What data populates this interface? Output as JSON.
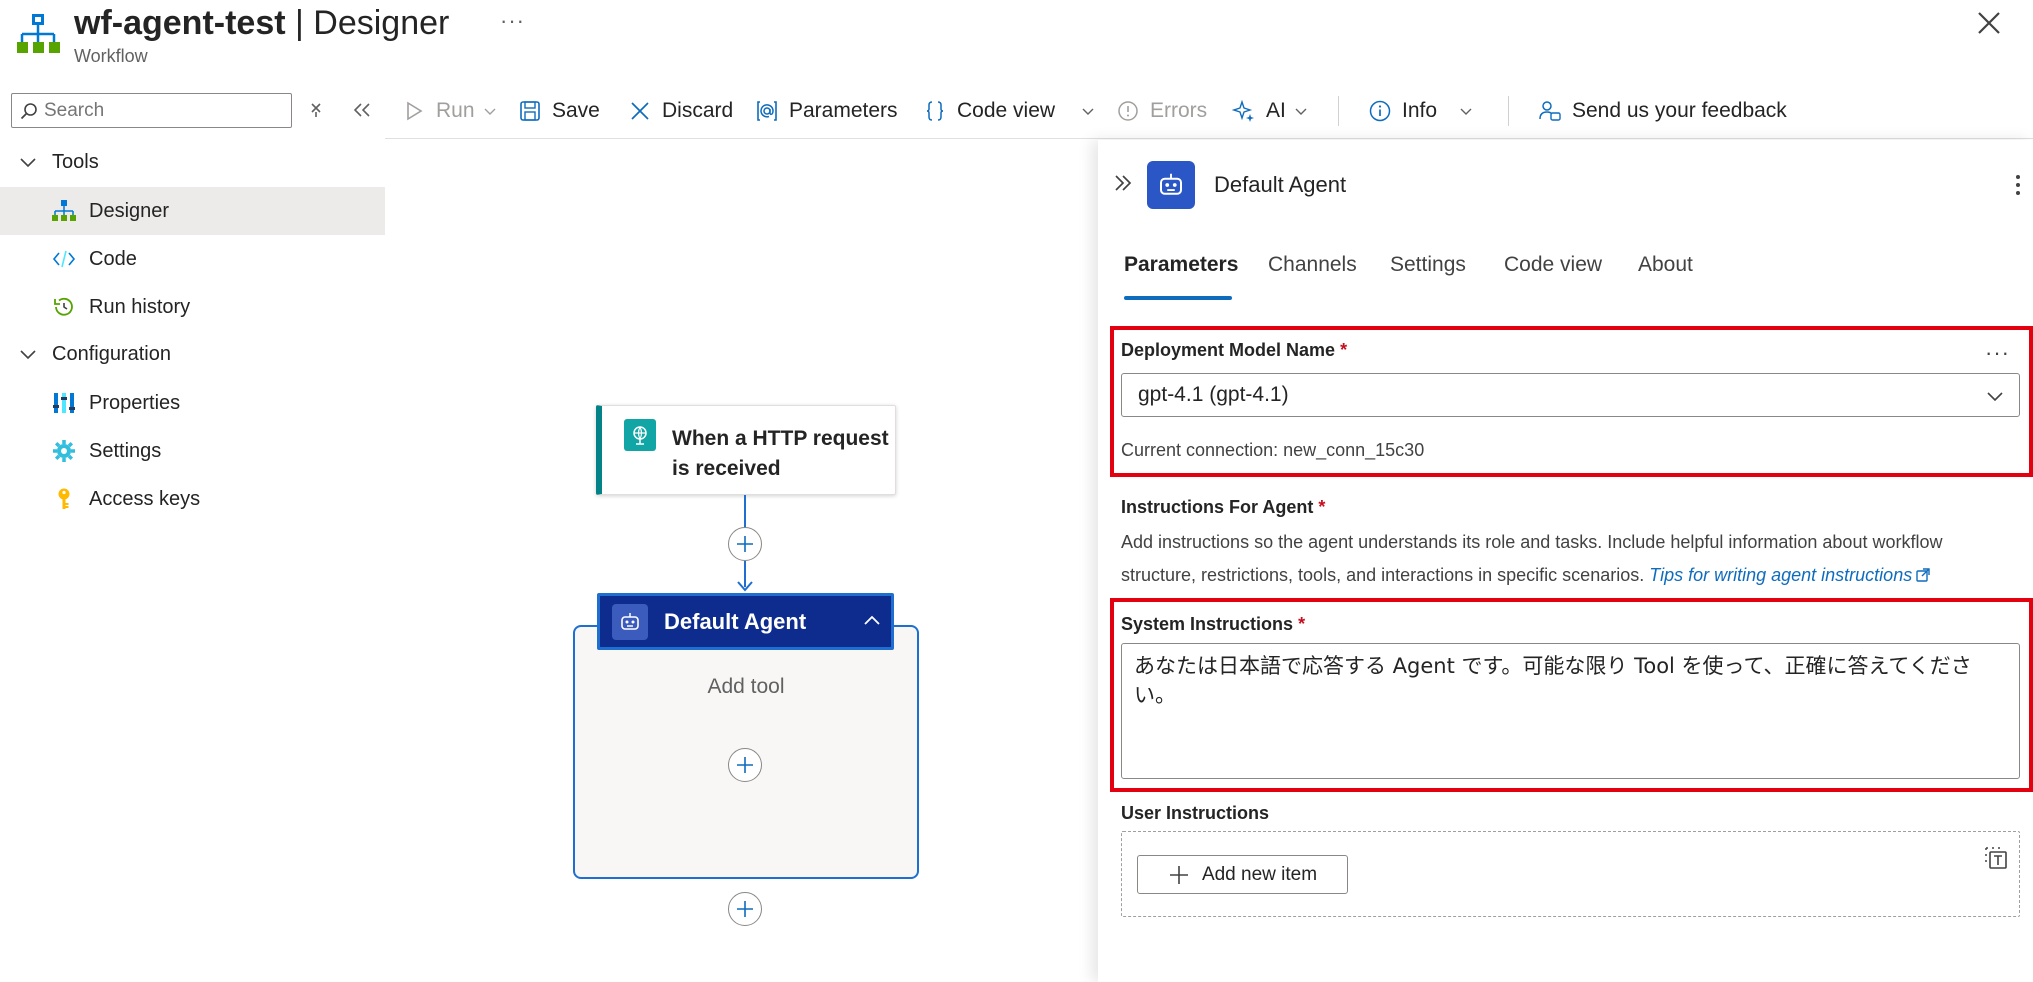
{
  "header": {
    "title_name": "wf-agent-test",
    "title_rest": " | Designer",
    "subtitle": "Workflow",
    "more": "···"
  },
  "search": {
    "placeholder": "Search"
  },
  "toolbar": {
    "run": "Run",
    "save": "Save",
    "discard": "Discard",
    "parameters": "Parameters",
    "code_view": "Code view",
    "errors": "Errors",
    "ai": "AI",
    "info": "Info",
    "feedback": "Send us your feedback"
  },
  "nav": {
    "groups": [
      {
        "label": "Tools"
      },
      {
        "label": "Configuration"
      }
    ],
    "items": [
      {
        "label": "Designer",
        "icon": "designer-icon",
        "selected": true
      },
      {
        "label": "Code",
        "icon": "code-icon"
      },
      {
        "label": "Run history",
        "icon": "history-icon"
      },
      {
        "label": "Properties",
        "icon": "properties-icon"
      },
      {
        "label": "Settings",
        "icon": "gear-icon"
      },
      {
        "label": "Access keys",
        "icon": "key-icon"
      }
    ]
  },
  "canvas": {
    "trigger_title": "When a HTTP request is received",
    "agent_title": "Default Agent",
    "add_tool": "Add tool"
  },
  "panel": {
    "title": "Default Agent",
    "tabs": [
      "Parameters",
      "Channels",
      "Settings",
      "Code view",
      "About"
    ],
    "active_tab": "Parameters",
    "deployment_label": "Deployment Model Name",
    "deployment_value": "gpt-4.1 (gpt-4.1)",
    "connection": "Current connection: new_conn_15c30",
    "instructions_label": "Instructions For Agent",
    "instructions_help": "Add instructions so the agent understands its role and tasks. Include helpful information about workflow structure, restrictions, tools, and interactions in specific scenarios.",
    "instructions_link": "Tips for writing agent instructions",
    "system_label": "System Instructions",
    "system_value": "あなたは日本語で応答する Agent です。可能な限り Tool を使って、正確に答えてください。",
    "user_label": "User Instructions",
    "add_item": "Add new item",
    "required_mark": "*"
  },
  "colors": {
    "accent": "#0f6cbd",
    "agent_header": "#0e2c8e",
    "trigger_stripe": "#038387",
    "highlight": "#e3000f"
  }
}
